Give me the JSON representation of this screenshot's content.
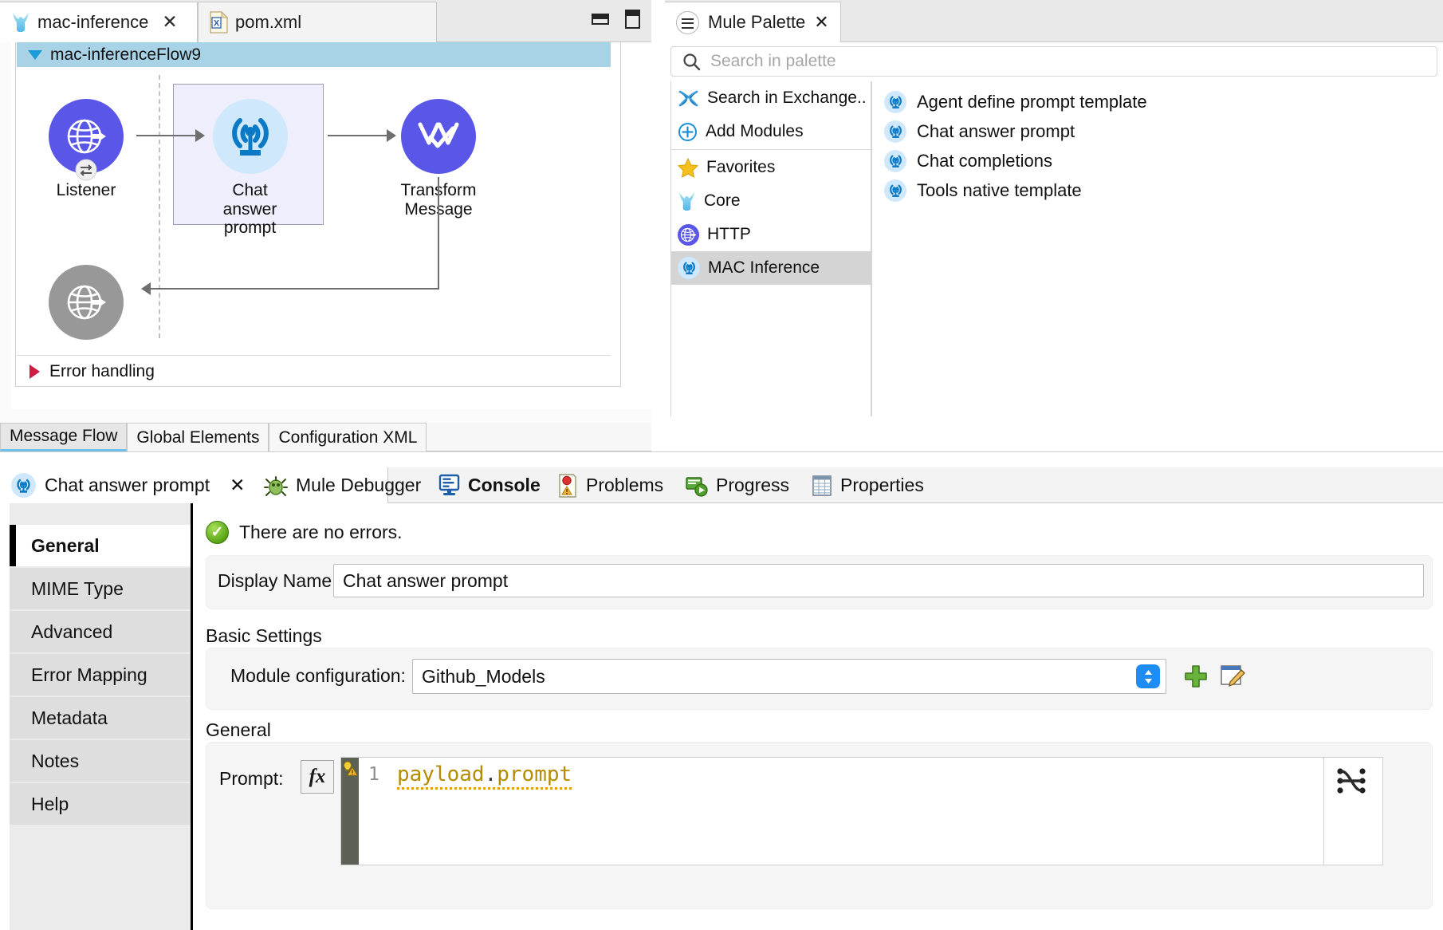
{
  "editor": {
    "tabs": [
      {
        "label": "mac-inference",
        "icon": "mule-logo-icon",
        "closable": true,
        "active": true
      },
      {
        "label": "pom.xml",
        "icon": "xml-file-icon",
        "closable": false,
        "active": false
      }
    ],
    "window_buttons": [
      "minimize-icon",
      "maximize-icon"
    ],
    "flow": {
      "name": "mac-inferenceFlow9",
      "error_handling_label": "Error handling",
      "nodes": [
        {
          "id": "listener",
          "label": "Listener",
          "icon": "http-listener-icon",
          "color": "#5a57e8",
          "selected": false
        },
        {
          "id": "chat-answer-prompt",
          "label": "Chat answer prompt",
          "icon": "mac-inference-icon",
          "color": "#cfe8fb",
          "selected": true
        },
        {
          "id": "transform-message",
          "label": "Transform Message",
          "icon": "transform-message-icon",
          "color": "#5a57e8",
          "selected": false
        },
        {
          "id": "error-response",
          "label": "",
          "icon": "http-listener-icon",
          "color": "#989898",
          "selected": false
        }
      ]
    },
    "bottom_tabs": [
      {
        "label": "Message Flow",
        "active": true
      },
      {
        "label": "Global Elements",
        "active": false
      },
      {
        "label": "Configuration XML",
        "active": false
      }
    ]
  },
  "palette": {
    "title": "Mule Palette",
    "menu_icon": "hamburger-icon",
    "close_icon": "close-icon",
    "search": {
      "placeholder": "Search in palette",
      "value": "",
      "icon": "search-icon"
    },
    "tree": [
      {
        "label": "Search in Exchange..",
        "icon": "exchange-icon",
        "selected": false
      },
      {
        "label": "Add Modules",
        "icon": "plus-circle-icon",
        "selected": false
      },
      {
        "label": "Favorites",
        "icon": "star-icon",
        "selected": false
      },
      {
        "label": "Core",
        "icon": "mule-logo-icon",
        "selected": false
      },
      {
        "label": "HTTP",
        "icon": "http-globe-icon",
        "selected": false
      },
      {
        "label": "MAC Inference",
        "icon": "mac-inference-icon",
        "selected": true
      }
    ],
    "operations": [
      {
        "label": "Agent define prompt template",
        "icon": "mac-inference-icon"
      },
      {
        "label": "Chat answer prompt",
        "icon": "mac-inference-icon"
      },
      {
        "label": "Chat completions",
        "icon": "mac-inference-icon"
      },
      {
        "label": "Tools native template",
        "icon": "mac-inference-icon"
      }
    ]
  },
  "bottom": {
    "tabs": [
      {
        "label": "Chat answer prompt",
        "icon": "mac-inference-icon",
        "active": true,
        "closable": true
      },
      {
        "label": "Mule Debugger",
        "icon": "debugger-icon",
        "active": false,
        "closable": false
      },
      {
        "label": "Console",
        "icon": "console-icon",
        "active": false,
        "bold": true,
        "closable": false
      },
      {
        "label": "Problems",
        "icon": "problems-icon",
        "active": false,
        "closable": false
      },
      {
        "label": "Progress",
        "icon": "progress-icon",
        "active": false,
        "closable": false
      },
      {
        "label": "Properties",
        "icon": "properties-icon",
        "active": false,
        "closable": false
      }
    ],
    "sidebar": [
      {
        "label": "General",
        "active": true
      },
      {
        "label": "MIME Type",
        "active": false
      },
      {
        "label": "Advanced",
        "active": false
      },
      {
        "label": "Error Mapping",
        "active": false
      },
      {
        "label": "Metadata",
        "active": false
      },
      {
        "label": "Notes",
        "active": false
      },
      {
        "label": "Help",
        "active": false
      }
    ],
    "status": {
      "text": "There are no errors.",
      "icon": "ok-check-icon"
    },
    "form": {
      "display_name_label": "Display Name:",
      "display_name_value": "Chat answer prompt",
      "basic_settings_title": "Basic Settings",
      "module_config_label": "Module configuration:",
      "module_config_value": "Github_Models",
      "module_config_dropdown_icon": "chevron-updown-icon",
      "add_button_icon": "plus-icon",
      "edit_button_icon": "edit-icon",
      "general_title": "General",
      "prompt_label": "Prompt:",
      "prompt_fx_label": "fx",
      "prompt_line_number": "1",
      "prompt_expression": "payload.prompt",
      "prompt_warning_icon": "warning-bulb-icon",
      "dataweave_icon": "dataweave-shuffle-icon"
    }
  },
  "colors": {
    "accent_purple": "#5a57e8",
    "mac_blue": "#0a7ac6",
    "flow_header_blue": "#a8d2e6",
    "selection_gray": "#d4d4d4"
  }
}
